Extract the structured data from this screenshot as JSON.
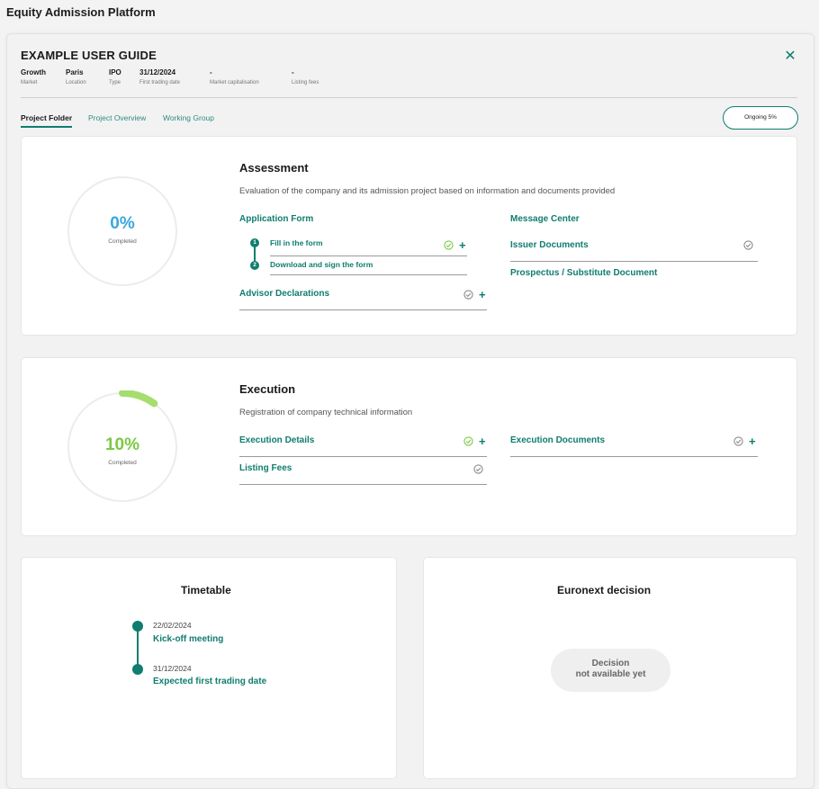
{
  "app_title": "Equity Admission Platform",
  "guide": {
    "title": "EXAMPLE USER GUIDE",
    "meta": [
      {
        "value": "Growth",
        "label": "Market"
      },
      {
        "value": "Paris",
        "label": "Location"
      },
      {
        "value": "IPO",
        "label": "Type"
      },
      {
        "value": "31/12/2024",
        "label": "First trading date"
      },
      {
        "value": "-",
        "label": "Market capitalisation"
      },
      {
        "value": "-",
        "label": "Listing fees"
      }
    ]
  },
  "tabs": [
    "Project Folder",
    "Project Overview",
    "Working Group"
  ],
  "status": "Ongoing 5%",
  "assessment": {
    "title": "Assessment",
    "description": "Evaluation of the company and its admission project based on information and documents provided",
    "progress_percent": 0,
    "progress_label": "0%",
    "completed_label": "Completed",
    "application_form": "Application Form",
    "steps": [
      {
        "num": "1",
        "label": "Fill in the form"
      },
      {
        "num": "2",
        "label": "Download and sign the form"
      }
    ],
    "advisor": "Advisor Declarations",
    "message_center": "Message Center",
    "issuer_documents": "Issuer Documents",
    "prospectus": "Prospectus / Substitute Document"
  },
  "execution": {
    "title": "Execution",
    "description": "Registration of company technical information",
    "progress_percent": 10,
    "progress_label": "10%",
    "completed_label": "Completed",
    "details": "Execution Details",
    "fees": "Listing Fees",
    "documents": "Execution Documents"
  },
  "timetable": {
    "title": "Timetable",
    "events": [
      {
        "date": "22/02/2024",
        "label": "Kick-off meeting"
      },
      {
        "date": "31/12/2024",
        "label": "Expected first trading date"
      }
    ]
  },
  "decision": {
    "title": "Euronext decision",
    "line1": "Decision",
    "line2": "not available yet"
  },
  "colors": {
    "accent": "#0f7d6f",
    "progress_green": "#7ac943",
    "progress_zero": "#3aa7e0",
    "check_green": "#7ac943"
  },
  "icons": [
    "close-icon",
    "check-circle-icon",
    "plus-icon"
  ]
}
